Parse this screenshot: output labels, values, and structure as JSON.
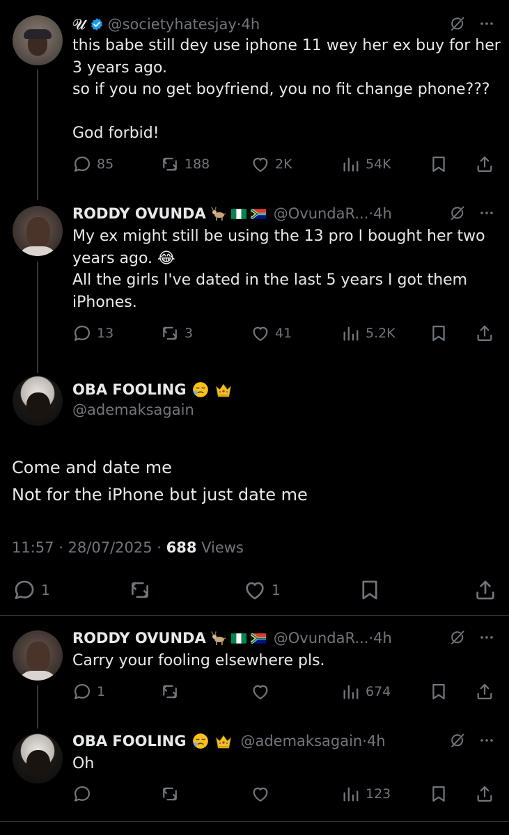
{
  "tweets": [
    {
      "display_name": "𝓤",
      "verified": true,
      "handle": "@societyhatesjay",
      "time": "4h",
      "text": "this babe still dey use iphone 11 wey her ex buy for her 3 years ago.\nso if you no get boyfriend, you no fit change phone???\n\nGod forbid!",
      "replies": "85",
      "reposts": "188",
      "likes": "2K",
      "views": "54K"
    },
    {
      "display_name": "RODDY OVUNDA",
      "handle": "@OvundaR...",
      "time": "4h",
      "text": "My ex might still be using the 13 pro I bought her two years ago. 😂\nAll the girls I've dated in the last 5 years I got them iPhones.",
      "replies": "13",
      "reposts": "3",
      "likes": "41",
      "views": "5.2K"
    }
  ],
  "main_tweet": {
    "display_name": "OBA FOOLING",
    "handle": "@ademaksagain",
    "text": "Come and date me\nNot for the iPhone but just date me",
    "timestamp": "11:57 · 28/07/2025 · ",
    "views_count": "688",
    "views_label": " Views",
    "replies": "1",
    "reposts": "",
    "likes": "1"
  },
  "replies": [
    {
      "display_name": "RODDY OVUNDA",
      "handle": "@OvundaR...",
      "time": "4h",
      "text": "Carry your fooling elsewhere pls.",
      "replies": "1",
      "reposts": "",
      "likes": "",
      "views": "674"
    },
    {
      "display_name": "OBA FOOLING",
      "handle": "@ademaksagain",
      "time": "4h",
      "text": "Oh",
      "replies": "",
      "reposts": "",
      "likes": "",
      "views": "123"
    }
  ],
  "separator": " · ",
  "colors": {
    "background": "#000000",
    "text": "#e7e9ea",
    "muted": "#71767b",
    "verified": "#1d9bf0",
    "divider": "#2f3336"
  }
}
